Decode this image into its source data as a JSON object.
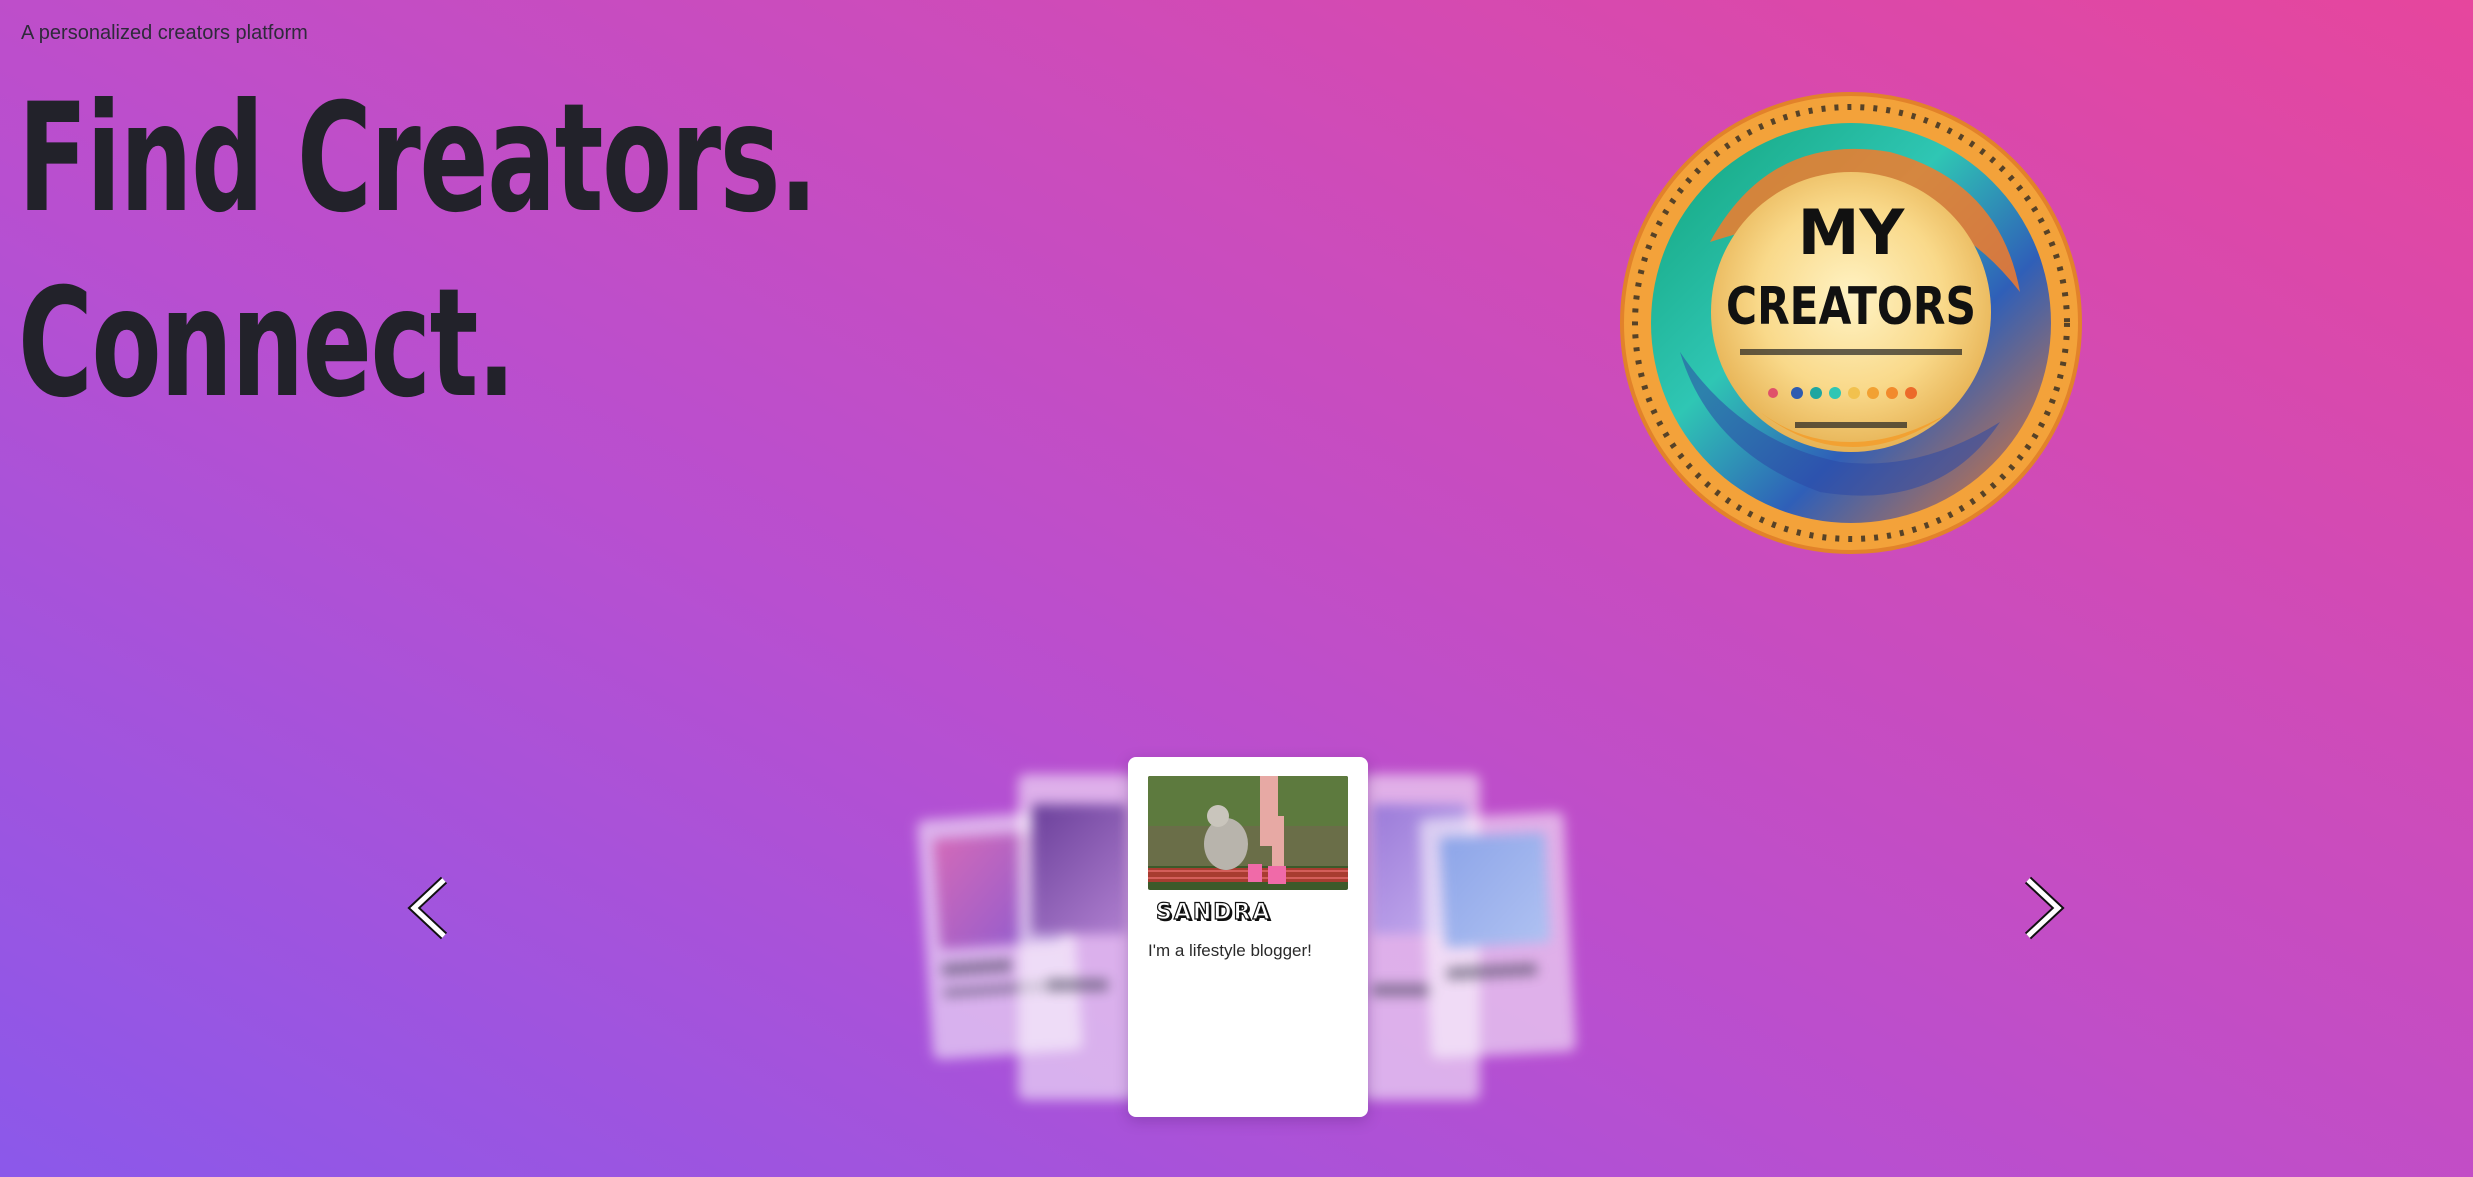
{
  "header": {
    "tagline": "A personalized creators platform",
    "headline_line1": "Find Creators.",
    "headline_line2": "Connect."
  },
  "logo": {
    "title_line1": "MY",
    "title_line2": "CREATORS",
    "icon": "my-creators-emblem"
  },
  "carousel": {
    "prev_icon": "chevron-left-icon",
    "next_icon": "chevron-right-icon",
    "active_card": {
      "name": "SANDRA",
      "bio": "I'm a lifestyle blogger!"
    }
  },
  "colors": {
    "gradient_start": "#8b58ea",
    "gradient_end": "#e6469d",
    "text_dark": "#22222a",
    "card_bg": "#ffffff"
  }
}
